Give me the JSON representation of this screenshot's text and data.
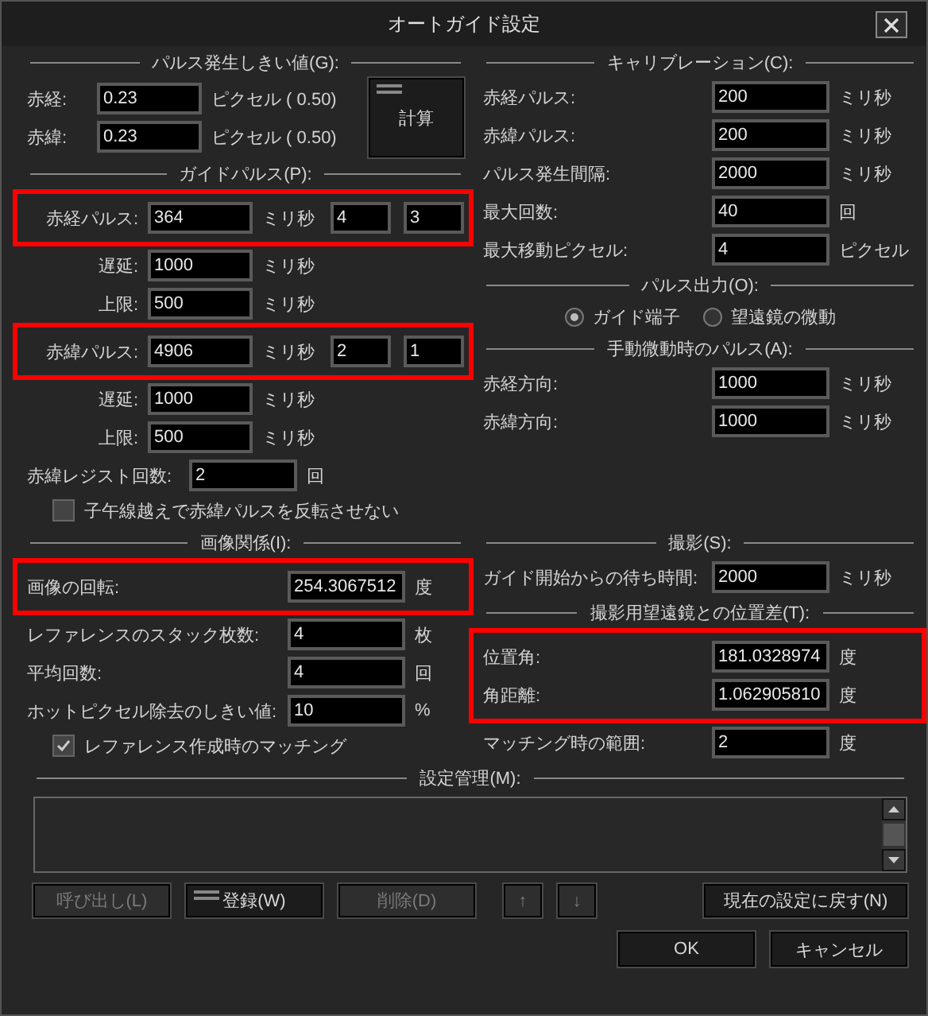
{
  "window": {
    "title": "オートガイド設定"
  },
  "threshold": {
    "title": "パルス発生しきい値(G):",
    "items": [
      {
        "kind": "field",
        "label": "赤経:",
        "value": "0.23",
        "unit": "ピクセル ( 0.50)",
        "highlighted": false
      },
      {
        "kind": "field",
        "label": "赤緯:",
        "value": "0.23",
        "unit": "ピクセル ( 0.50)",
        "highlighted": false
      }
    ],
    "button": {
      "label": "計算",
      "default": true
    }
  },
  "guide_pulse": {
    "title": "ガイドパルス(P):",
    "items": [
      {
        "kind": "pulse",
        "label": "赤経パルス:",
        "value": "364",
        "unit": "ミリ秒",
        "extra": [
          "4",
          "3"
        ],
        "highlighted": true
      },
      {
        "kind": "sub",
        "label": "遅延:",
        "value": "1000",
        "unit": "ミリ秒",
        "highlighted": false
      },
      {
        "kind": "sub",
        "label": "上限:",
        "value": "500",
        "unit": "ミリ秒",
        "highlighted": false
      },
      {
        "kind": "pulse",
        "label": "赤緯パルス:",
        "value": "4906",
        "unit": "ミリ秒",
        "extra": [
          "2",
          "1"
        ],
        "highlighted": true
      },
      {
        "kind": "sub",
        "label": "遅延:",
        "value": "1000",
        "unit": "ミリ秒",
        "highlighted": false
      },
      {
        "kind": "sub",
        "label": "上限:",
        "value": "500",
        "unit": "ミリ秒",
        "highlighted": false
      },
      {
        "kind": "register",
        "label": "赤緯レジスト回数:",
        "value": "2",
        "unit": "回",
        "highlighted": false
      },
      {
        "kind": "checkbox",
        "label": "子午線越えで赤緯パルスを反転させない",
        "checked": false,
        "highlighted": false
      }
    ]
  },
  "image": {
    "title": "画像関係(I):",
    "items": [
      {
        "kind": "field",
        "label": "画像の回転:",
        "value": "254.3067512",
        "unit": "度",
        "highlighted": true
      },
      {
        "kind": "field",
        "label": "レファレンスのスタック枚数:",
        "value": "4",
        "unit": "枚",
        "highlighted": false
      },
      {
        "kind": "field",
        "label": "平均回数:",
        "value": "4",
        "unit": "回",
        "highlighted": false
      },
      {
        "kind": "field",
        "label": "ホットピクセル除去のしきい値:",
        "value": "10",
        "unit": "%",
        "highlighted": false
      },
      {
        "kind": "checkbox",
        "label": "レファレンス作成時のマッチング",
        "checked": true,
        "highlighted": false
      }
    ]
  },
  "calibration": {
    "title": "キャリブレーション(C):",
    "items": [
      {
        "kind": "field",
        "label": "赤経パルス:",
        "value": "200",
        "unit": "ミリ秒",
        "highlighted": false
      },
      {
        "kind": "field",
        "label": "赤緯パルス:",
        "value": "200",
        "unit": "ミリ秒",
        "highlighted": false
      },
      {
        "kind": "field",
        "label": "パルス発生間隔:",
        "value": "2000",
        "unit": "ミリ秒",
        "highlighted": false
      },
      {
        "kind": "field",
        "label": "最大回数:",
        "value": "40",
        "unit": "回",
        "highlighted": false
      },
      {
        "kind": "field",
        "label": "最大移動ピクセル:",
        "value": "4",
        "unit": "ピクセル",
        "highlighted": false
      }
    ]
  },
  "pulse_output": {
    "title": "パルス出力(O):",
    "options": [
      {
        "label": "ガイド端子",
        "selected": true
      },
      {
        "label": "望遠鏡の微動",
        "selected": false
      }
    ]
  },
  "manual_pulse": {
    "title": "手動微動時のパルス(A):",
    "items": [
      {
        "kind": "field",
        "label": "赤経方向:",
        "value": "1000",
        "unit": "ミリ秒",
        "highlighted": false
      },
      {
        "kind": "field",
        "label": "赤緯方向:",
        "value": "1000",
        "unit": "ミリ秒",
        "highlighted": false
      }
    ]
  },
  "shooting": {
    "title": "撮影(S):",
    "items": [
      {
        "kind": "field",
        "label": "ガイド開始からの待ち時間:",
        "value": "2000",
        "unit": "ミリ秒",
        "highlighted": false
      }
    ]
  },
  "offset": {
    "title": "撮影用望遠鏡との位置差(T):",
    "items": [
      {
        "kind": "field",
        "label": "位置角:",
        "value": "181.0328974",
        "unit": "度",
        "highlighted": true
      },
      {
        "kind": "field",
        "label": "角距離:",
        "value": "1.062905810",
        "unit": "度",
        "highlighted": true
      },
      {
        "kind": "field",
        "label": "マッチング時の範囲:",
        "value": "2",
        "unit": "度",
        "highlighted": false
      }
    ]
  },
  "settings": {
    "title": "設定管理(M):",
    "buttons": [
      {
        "kind": "text",
        "label": "呼び出し(L)",
        "disabled": true,
        "default": false
      },
      {
        "kind": "text",
        "label": "登録(W)",
        "disabled": false,
        "default": true
      },
      {
        "kind": "text",
        "label": "削除(D)",
        "disabled": true,
        "default": false
      },
      {
        "kind": "arrow",
        "label": "↑",
        "disabled": true,
        "default": false
      },
      {
        "kind": "arrow",
        "label": "↓",
        "disabled": true,
        "default": false
      }
    ],
    "restore": "現在の設定に戻す(N)"
  },
  "footer": {
    "buttons": [
      "OK",
      "キャンセル"
    ]
  }
}
